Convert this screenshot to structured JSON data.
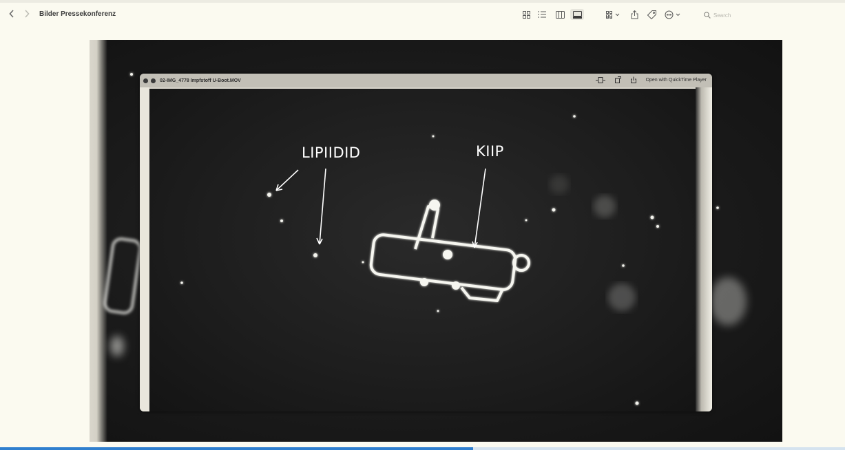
{
  "window": {
    "title": "Bilder Pressekonferenz",
    "search_placeholder": "Search"
  },
  "toolbar": {
    "icons": [
      "grid-view-icon",
      "list-view-icon",
      "column-view-icon",
      "gallery-view-icon",
      "group-icon",
      "share-icon",
      "tag-icon",
      "more-actions-icon"
    ],
    "active_view": "gallery"
  },
  "preview": {
    "inner_window_title": "02-IMG_4778 Impfstoff U-Boot.MOV",
    "open_with_label": "Open with QuickTime Player",
    "annotations": {
      "left": "LIPIIDID",
      "right": "KIIP"
    }
  },
  "colors": {
    "background": "#fbfaf0",
    "accent": "#2f7fce",
    "annotation": "#ffffff"
  },
  "progress": {
    "fraction": 0.56
  }
}
